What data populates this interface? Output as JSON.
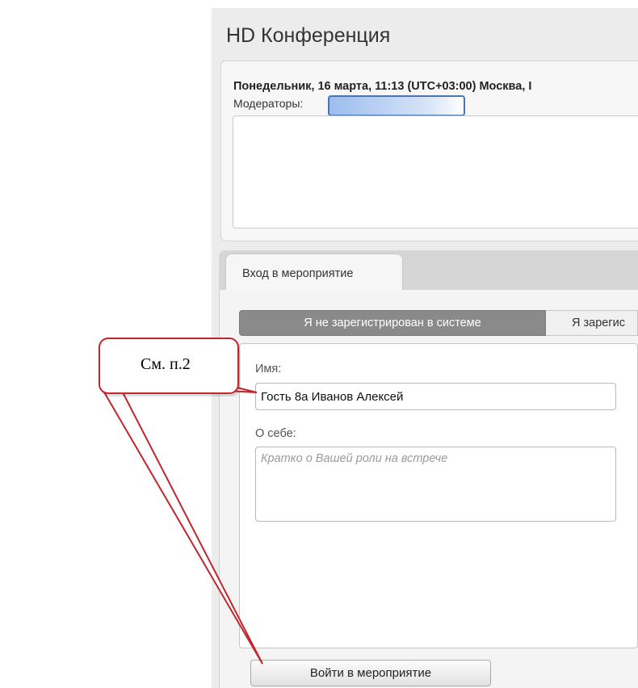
{
  "app": {
    "title": "HD Конференция"
  },
  "event": {
    "datetime": "Понедельник, 16 марта, 11:13  (UTC+03:00) Москва, I",
    "moderators_label": "Модераторы:"
  },
  "tabs": [
    {
      "label": "Вход в мероприятие"
    }
  ],
  "segmented": {
    "unregistered": "Я не зарегистрирован в системе",
    "registered": "Я зарегис"
  },
  "form": {
    "name_label": "Имя:",
    "name_value": "Гость 8а Иванов Алексей",
    "about_label": "О себе:",
    "about_placeholder": "Кратко о Вашей роли на встрече",
    "submit_label": "Войти в мероприятие"
  },
  "annotation": {
    "callout_text": "См. п.2",
    "color": "#c0262c"
  }
}
